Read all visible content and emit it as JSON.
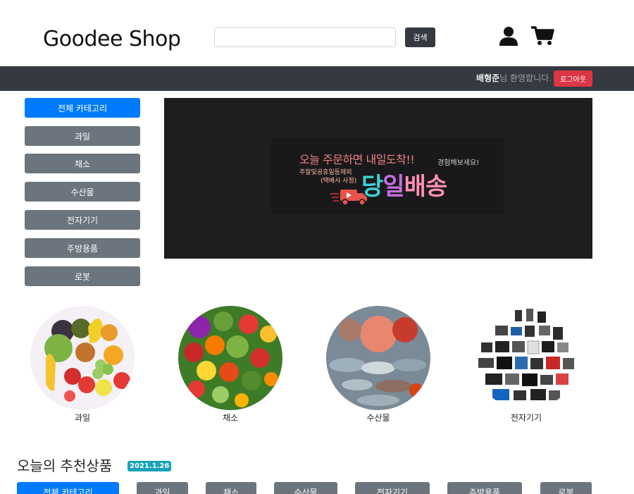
{
  "header": {
    "logo": "Goodee Shop",
    "search_placeholder": "",
    "search_button": "검색",
    "user_icon": "user-icon",
    "cart_icon": "cart-icon"
  },
  "navbar": {
    "user_name": "배형준",
    "welcome_suffix": "님 환영합니다.",
    "logout_button": "로그아웃"
  },
  "sidebar": {
    "items": [
      {
        "label": "전체 카테고리",
        "active": true
      },
      {
        "label": "과일"
      },
      {
        "label": "채소"
      },
      {
        "label": "수산물"
      },
      {
        "label": "전자기기"
      },
      {
        "label": "주방용품"
      },
      {
        "label": "로봇"
      }
    ]
  },
  "banner": {
    "line1": "오늘 주문하면 내일도착!!",
    "side_note": "경험해보세요!",
    "sub1": "주말및공휴일등제외",
    "sub2": "(택배사 사정)",
    "big_1": "당",
    "big_2": "일",
    "big_3": "배송"
  },
  "categories": [
    {
      "label": "과일"
    },
    {
      "label": "채소"
    },
    {
      "label": "수산물"
    },
    {
      "label": "전자기기"
    }
  ],
  "recommend": {
    "title": "오늘의 추천상품",
    "date_badge": "2021.1.26",
    "tabs": [
      {
        "label": "전체 카테고리",
        "active": true
      },
      {
        "label": "과일"
      },
      {
        "label": "채소"
      },
      {
        "label": "수산물"
      },
      {
        "label": "전자기기"
      },
      {
        "label": "주방용품"
      },
      {
        "label": "로봇"
      }
    ]
  },
  "colors": {
    "primary": "#007bff",
    "secondary": "#6c757d",
    "dark": "#343a40",
    "danger": "#dc3545",
    "info": "#17a2b8"
  }
}
